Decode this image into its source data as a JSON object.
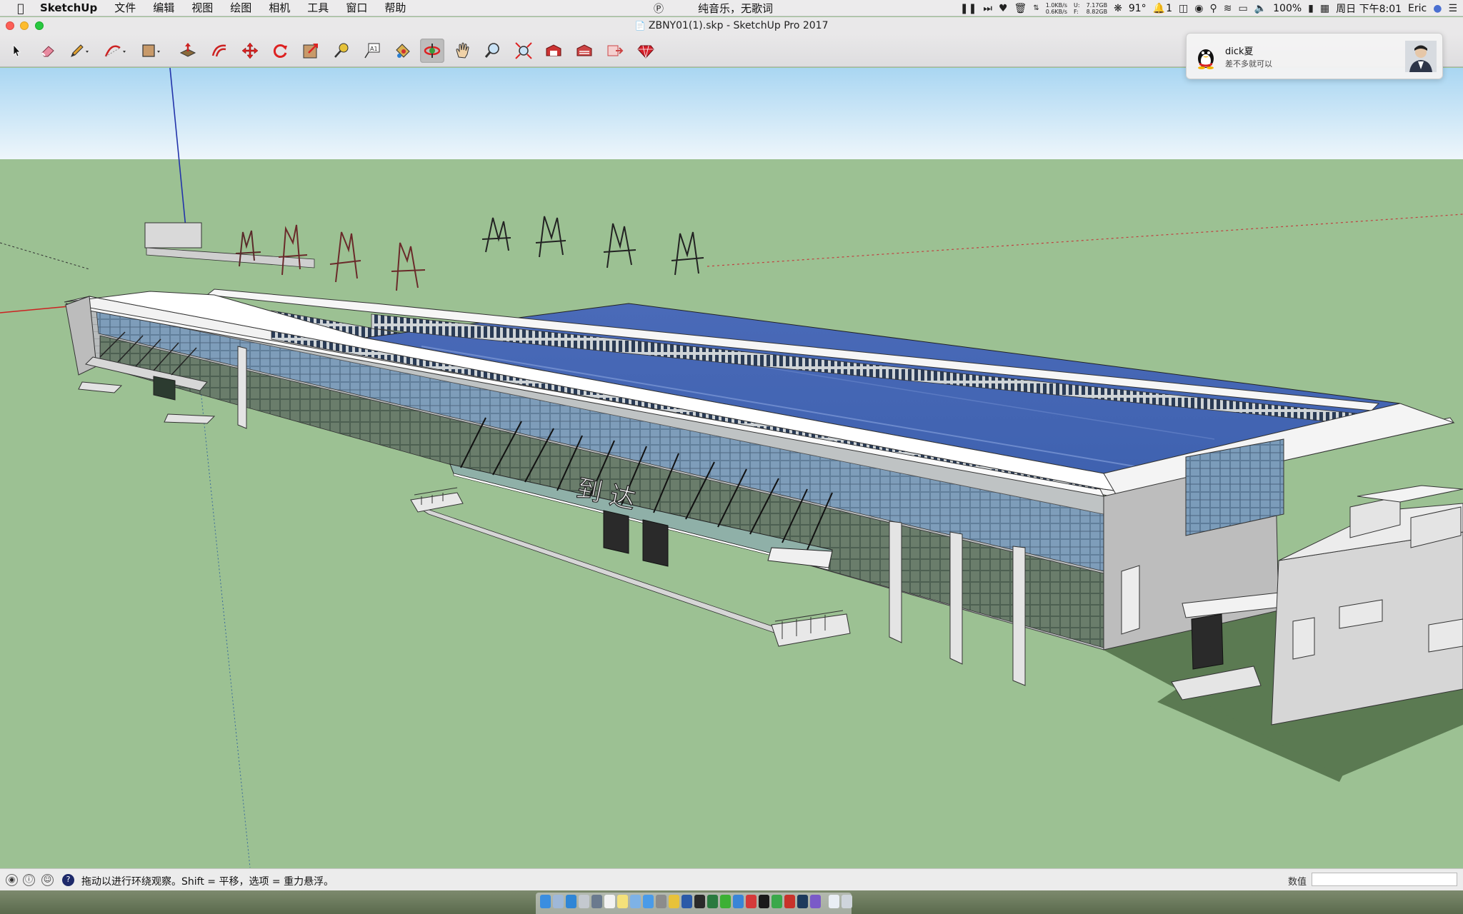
{
  "menubar": {
    "app_name": "SketchUp",
    "menus": [
      "文件",
      "编辑",
      "视图",
      "绘图",
      "相机",
      "工具",
      "窗口",
      "帮助"
    ],
    "now_playing": "纯音乐，无歌词",
    "net_up": "1.0KB/s",
    "net_down": "0.6KB/s",
    "disk_u_label": "U:",
    "disk_f_label": "F:",
    "mem_used": "7.17GB",
    "mem_free": "8.82GB",
    "temperature": "91°",
    "alert_count": "1",
    "battery": "100%",
    "clock": "周日 下午8:01",
    "user": "Eric"
  },
  "window": {
    "title": "ZBNY01(1).skp - SketchUp Pro 2017"
  },
  "toolbar": {
    "tools": [
      {
        "name": "select-tool",
        "icon": "arrow-cursor-icon"
      },
      {
        "name": "eraser-tool",
        "icon": "eraser-icon"
      },
      {
        "name": "pencil-tool",
        "icon": "pencil-icon"
      },
      {
        "name": "arc-tool",
        "icon": "arc-icon"
      },
      {
        "name": "shape-tool",
        "icon": "rectangle-icon"
      },
      {
        "name": "push-pull-tool",
        "icon": "push-pull-icon"
      },
      {
        "name": "offset-tool",
        "icon": "offset-icon"
      },
      {
        "name": "move-tool",
        "icon": "move-arrows-icon"
      },
      {
        "name": "rotate-tool",
        "icon": "rotate-icon"
      },
      {
        "name": "scale-tool",
        "icon": "scale-icon"
      },
      {
        "name": "tape-measure-tool",
        "icon": "tape-measure-icon"
      },
      {
        "name": "text-tool",
        "icon": "text-label-icon"
      },
      {
        "name": "paint-bucket-tool",
        "icon": "paint-bucket-icon"
      },
      {
        "name": "orbit-tool",
        "icon": "orbit-icon"
      },
      {
        "name": "pan-tool",
        "icon": "hand-icon"
      },
      {
        "name": "zoom-tool",
        "icon": "magnifier-icon"
      },
      {
        "name": "zoom-extents-tool",
        "icon": "zoom-extents-icon"
      },
      {
        "name": "3d-warehouse-tool",
        "icon": "warehouse-icon"
      },
      {
        "name": "extension-warehouse-tool",
        "icon": "extension-icon"
      },
      {
        "name": "layout-tool",
        "icon": "layout-icon"
      },
      {
        "name": "extension-manager-tool",
        "icon": "ruby-gem-icon"
      }
    ],
    "active_tool": "orbit-tool"
  },
  "model": {
    "sign_arrival": "到 达"
  },
  "notification": {
    "sender": "dick夏",
    "message": "差不多就可以"
  },
  "statusbar": {
    "hint": "拖动以进行环绕观察。Shift = 平移，选项 = 重力悬浮。",
    "measurement_label": "数值",
    "measurement_value": ""
  },
  "colors": {
    "sky_top": "#a9d6f2",
    "sky_bottom": "#eef6fb",
    "ground": "#9cc193",
    "roof_glass": "#3a5aa8",
    "shadow": "#5a7452"
  }
}
